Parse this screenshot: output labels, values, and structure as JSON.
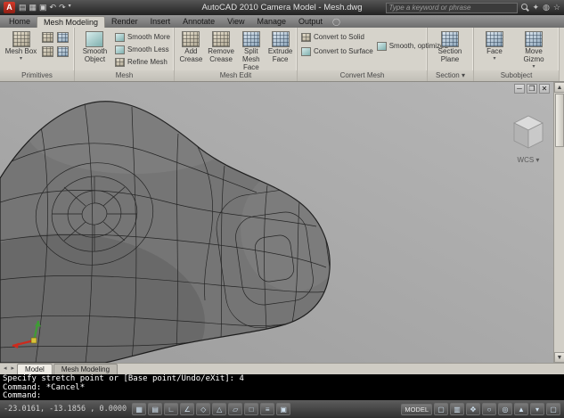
{
  "titlebar": {
    "app_title": "AutoCAD 2010   Camera Model - Mesh.dwg",
    "search_placeholder": "Type a keyword or phrase"
  },
  "ribbon_tabs": [
    {
      "label": "Home"
    },
    {
      "label": "Mesh Modeling"
    },
    {
      "label": "Render"
    },
    {
      "label": "Insert"
    },
    {
      "label": "Annotate"
    },
    {
      "label": "View"
    },
    {
      "label": "Manage"
    },
    {
      "label": "Output"
    }
  ],
  "panels": {
    "primitives": {
      "label": "Primitives",
      "mesh_box": "Mesh Box"
    },
    "mesh": {
      "label": "Mesh",
      "smooth_object": "Smooth Object",
      "smooth_more": "Smooth More",
      "smooth_less": "Smooth Less",
      "refine_mesh": "Refine Mesh"
    },
    "mesh_edit": {
      "label": "Mesh Edit",
      "add_crease": "Add Crease",
      "remove_crease": "Remove Crease",
      "split_mesh_face": "Split Mesh Face",
      "extrude_face": "Extrude Face"
    },
    "convert_mesh": {
      "label": "Convert Mesh",
      "convert_to_solid": "Convert to Solid",
      "convert_to_surface": "Convert to Surface",
      "smooth_optimized": "Smooth, optimized"
    },
    "section": {
      "label": "Section",
      "section_plane": "Section Plane"
    },
    "subobject": {
      "label": "Subobject",
      "face": "Face",
      "move_gizmo": "Move Gizmo"
    }
  },
  "viewport": {
    "wcs_label": "WCS"
  },
  "layout_tabs": [
    {
      "label": "Model"
    },
    {
      "label": "Mesh Modeling"
    }
  ],
  "command": {
    "lines": [
      "Specify stretch point or [Base point/Undo/eXit]: 4",
      "Command: *Cancel*",
      "Command:"
    ]
  },
  "statusbar": {
    "coordinates": "-23.0161, -13.1856 , 0.0000",
    "model_label": "MODEL"
  }
}
